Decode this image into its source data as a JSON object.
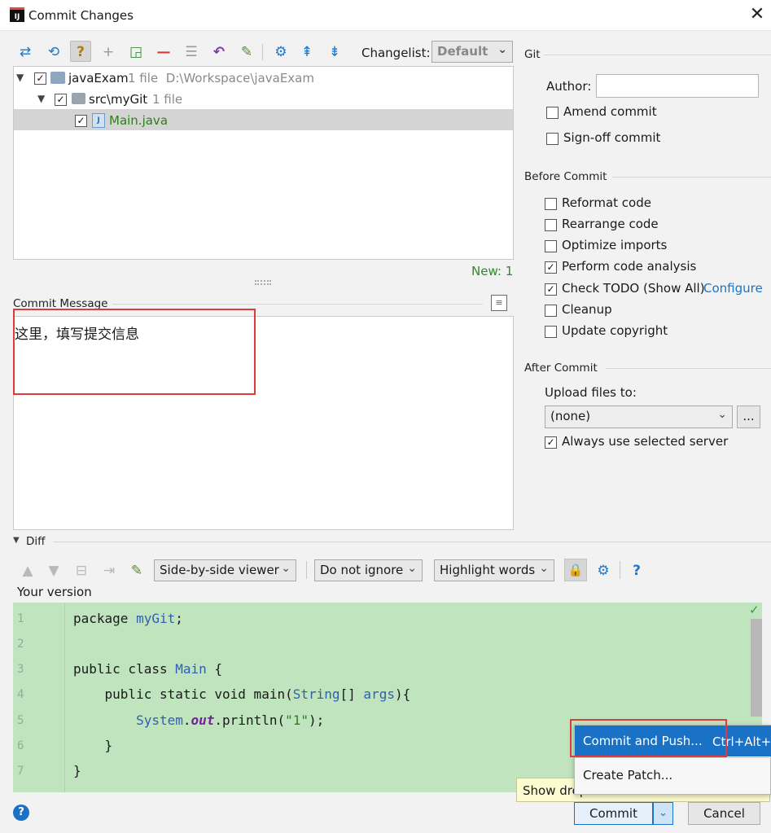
{
  "window": {
    "title": "Commit Changes",
    "app_icon_text": "IJ",
    "close_glyph": "✕"
  },
  "toolbar": {
    "icons": [
      "move-icon",
      "refresh-icon",
      "help-question-icon",
      "add-icon",
      "expand-icon",
      "remove-icon",
      "group-icon",
      "undo-icon",
      "edit-icon",
      "settings-icon",
      "expand-all-icon",
      "collapse-all-icon"
    ],
    "changelist_label": "Changelist:",
    "changelist_value": "Default"
  },
  "tree": {
    "root": {
      "name": "javaExam",
      "info": "1 file  D:\\Workspace\\javaExam"
    },
    "folder": {
      "name": "src\\myGit",
      "info": "1 file"
    },
    "file": {
      "name": "Main.java"
    },
    "status": "New: 1"
  },
  "commit_message": {
    "header": "Commit Message",
    "text": "这里，填写提交信息"
  },
  "git": {
    "header": "Git",
    "author_label": "Author:",
    "author_value": "",
    "amend": "Amend commit",
    "signoff": "Sign-off commit"
  },
  "before_commit": {
    "header": "Before Commit",
    "options": [
      {
        "label": "Reformat code",
        "checked": false
      },
      {
        "label": "Rearrange code",
        "checked": false
      },
      {
        "label": "Optimize imports",
        "checked": false
      },
      {
        "label": "Perform code analysis",
        "checked": true
      },
      {
        "label": "Check TODO (Show All)",
        "checked": true
      },
      {
        "label": "Cleanup",
        "checked": false
      },
      {
        "label": "Update copyright",
        "checked": false
      }
    ],
    "configure_link": "Configure"
  },
  "after_commit": {
    "header": "After Commit",
    "upload_label": "Upload files to:",
    "upload_value": "(none)",
    "browse_label": "...",
    "always_use": "Always use selected server"
  },
  "diff": {
    "header": "Diff",
    "viewer": "Side-by-side viewer",
    "ignore": "Do not ignore",
    "highlight": "Highlight words",
    "your_version": "Your version",
    "line_numbers": [
      "1",
      "2",
      "3",
      "4",
      "5",
      "6",
      "7"
    ]
  },
  "popup": {
    "commit_and_push": "Commit and Push...",
    "shortcut": "Ctrl+Alt+K",
    "create_patch": "Create Patch...",
    "tooltip": "Show drop-down menu"
  },
  "buttons": {
    "commit": "Commit",
    "cancel": "Cancel",
    "help": "?"
  },
  "colors": {
    "accent": "#1a72c7",
    "diff_added_bg": "#bfe4be",
    "red_highlight": "#e03a3a",
    "file_green": "#2f7d1f"
  }
}
